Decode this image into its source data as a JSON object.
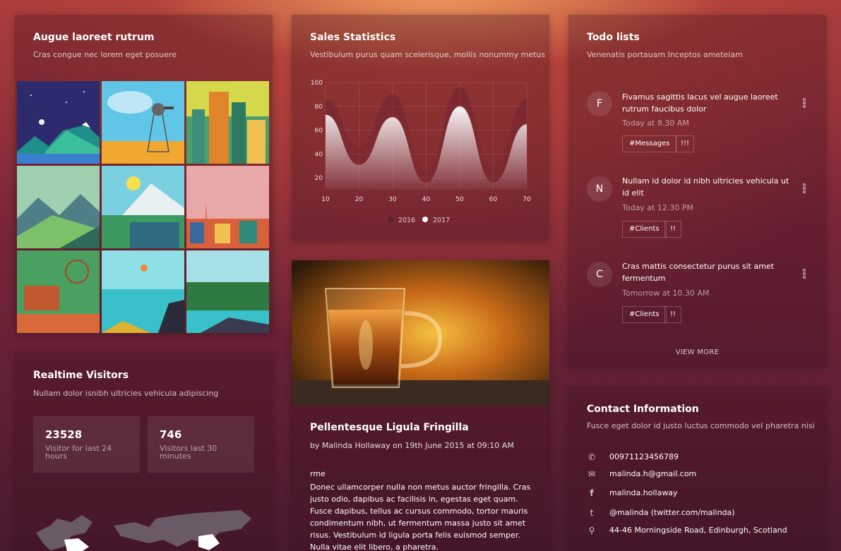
{
  "gallery_card": {
    "title": "Augue laoreet rutrum",
    "subtitle": "Cras congue nec lorem eget posuere"
  },
  "visitors_card": {
    "title": "Realtime Visitors",
    "subtitle": "Nullam dolor isnibh ultricies vehicula adipiscing",
    "stats": [
      {
        "value": "23528",
        "label": "Visitor for last 24 hours"
      },
      {
        "value": "746",
        "label": "Visitors last 30 minutes"
      }
    ]
  },
  "sales_card": {
    "title": "Sales Statistics",
    "subtitle": "Vestibulum purus quam scelerisque, mollis nonummy metus"
  },
  "chart_data": {
    "type": "area",
    "x_ticks": [
      "10",
      "20",
      "30",
      "40",
      "50",
      "60",
      "70"
    ],
    "y_ticks": [
      "20",
      "40",
      "60",
      "80",
      "100"
    ],
    "xlim": [
      10,
      70
    ],
    "ylim": [
      10,
      100
    ],
    "grid": true,
    "legend_position": "bottom",
    "series": [
      {
        "name": "2016",
        "color": "#5a2030",
        "x": [
          10,
          20,
          30,
          40,
          50,
          60,
          70
        ],
        "y": [
          86,
          46,
          90,
          26,
          96,
          30,
          86
        ]
      },
      {
        "name": "2017",
        "color": "#ffffff",
        "x": [
          10,
          20,
          30,
          40,
          50,
          60,
          70
        ],
        "y": [
          73,
          31,
          71,
          16,
          80,
          16,
          65
        ]
      }
    ]
  },
  "blog_card": {
    "title": "Pellentesque Ligula Fringilla",
    "byline": "by Malinda Hollaway on 19th June 2015 at 09:10 AM",
    "body_lead": "rme",
    "body": "Donec ullamcorper nulla non metus auctor fringilla. Cras justo odio, dapibus ac facilisis in, egestas eget quam. Fusce dapibus, tellus ac cursus commodo, tortor mauris condimentum nibh, ut fermentum massa justo sit amet risus. Vestibulum id ligula porta felis euismod semper. Nulla vitae elit libero, a pharetra."
  },
  "todo_card": {
    "title": "Todo lists",
    "subtitle": "Venenatis portauam Inceptos ameteiam",
    "items": [
      {
        "initial": "F",
        "text": "Fivamus sagittis lacus vel augue laoreet rutrum faucibus dolor",
        "time": "Today at 8.30 AM",
        "tags": [
          "#Messages",
          "!!!"
        ]
      },
      {
        "initial": "N",
        "text": "Nullam id dolor id nibh ultricies vehicula ut id elit",
        "time": "Today at 12.30 PM",
        "tags": [
          "#Clients",
          "!!"
        ]
      },
      {
        "initial": "C",
        "text": "Cras mattis consectetur purus sit amet fermentum",
        "time": "Tomorrow at 10.30 AM",
        "tags": [
          "#Clients",
          "!!"
        ]
      }
    ],
    "view_more": "VIEW MORE"
  },
  "contact_card": {
    "title": "Contact Information",
    "subtitle": "Fusce eget dolor id justo luctus commodo vel pharetra nisi",
    "rows": [
      {
        "icon": "phone-icon",
        "text": "00971123456789"
      },
      {
        "icon": "mail-icon",
        "text": "malinda.h@gmail.com"
      },
      {
        "icon": "facebook-icon",
        "text": "malinda.hollaway"
      },
      {
        "icon": "twitter-icon",
        "text": "@malinda (twitter.com/malinda)"
      },
      {
        "icon": "location-icon",
        "text": "44-46 Morningside Road, Edinburgh, Scotland"
      }
    ]
  }
}
